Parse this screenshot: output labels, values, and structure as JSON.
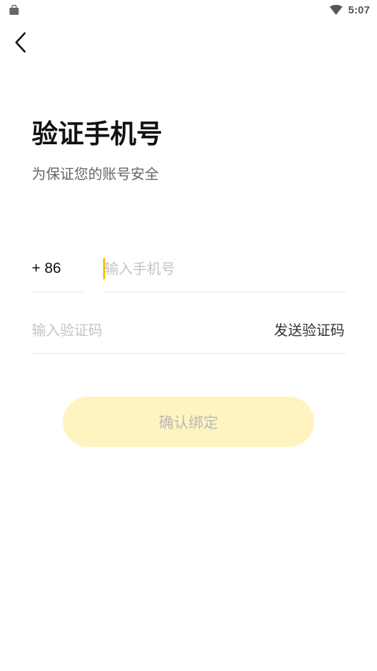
{
  "status_bar": {
    "time": "5:07",
    "left_icon": "shopping-bag-icon",
    "right_icon": "wifi-icon"
  },
  "nav": {
    "back_icon": "chevron-left-icon"
  },
  "header": {
    "title": "验证手机号",
    "subtitle": "为保证您的账号安全"
  },
  "form": {
    "country_code": "+ 86",
    "phone_placeholder": "输入手机号",
    "phone_value": "",
    "code_placeholder": "输入验证码",
    "code_value": "",
    "send_code_label": "发送验证码",
    "confirm_label": "确认绑定"
  },
  "colors": {
    "accent": "#f7c600",
    "button_disabled_bg": "#fff4bf",
    "button_disabled_text": "#b9b9b9",
    "placeholder": "#c4c4c4"
  }
}
